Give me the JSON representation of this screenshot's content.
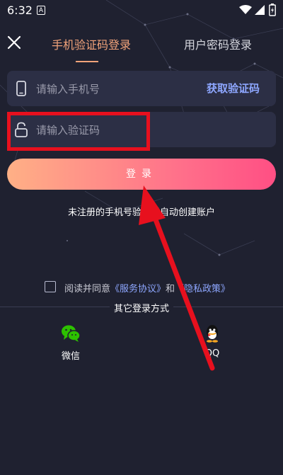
{
  "status_bar": {
    "time": "6:32",
    "app_icon_letter": "A",
    "icons": [
      "wifi-icon",
      "signal-icon",
      "battery-charging-icon"
    ]
  },
  "header": {
    "close_icon": "close-icon",
    "tabs": [
      {
        "label": "手机验证码登录",
        "active": true
      },
      {
        "label": "用户密码登录",
        "active": false
      }
    ],
    "active_color": "#f2a37a"
  },
  "form": {
    "phone": {
      "icon": "phone-icon",
      "placeholder": "请输入手机号",
      "action_label": "获取验证码"
    },
    "code": {
      "icon": "lock-icon",
      "placeholder": "请输入验证码"
    },
    "login_label": "登录",
    "note": "未注册的手机号验证后自动创建账户"
  },
  "agreement": {
    "prefix": "阅读并同意",
    "service_link": "《服务协议》",
    "conjunction": "和",
    "privacy_link": "《隐私政策》",
    "checked": false
  },
  "other_login": {
    "title": "其它登录方式",
    "methods": [
      {
        "label": "微信",
        "icon": "wechat-icon"
      },
      {
        "label": "QQ",
        "icon": "qq-icon"
      }
    ]
  },
  "colors": {
    "background": "#1f2130",
    "field": "#2c2f45",
    "link": "#8ea7ff",
    "button_gradient": [
      "#ffb086",
      "#ff4f84"
    ],
    "annotation": "#e7101e"
  }
}
